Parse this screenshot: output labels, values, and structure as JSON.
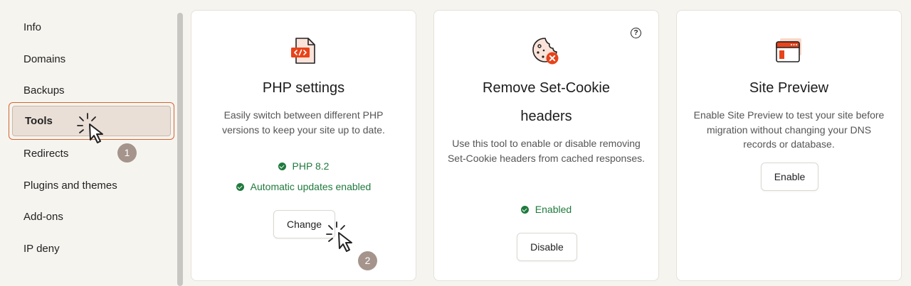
{
  "sidebar": {
    "items": [
      {
        "label": "Info"
      },
      {
        "label": "Domains"
      },
      {
        "label": "Backups"
      },
      {
        "label": "Tools"
      },
      {
        "label": "Redirects"
      },
      {
        "label": "Plugins and themes"
      },
      {
        "label": "Add-ons"
      },
      {
        "label": "IP deny"
      }
    ],
    "active_item": "Tools"
  },
  "step_badges": [
    "1",
    "2"
  ],
  "cards": {
    "php": {
      "title": "PHP settings",
      "description": "Easily switch between different PHP versions to keep your site up to date.",
      "status_1": "PHP 8.2",
      "status_2": "Automatic updates enabled",
      "button": "Change"
    },
    "cookie": {
      "title_line1": "Remove Set-Cookie",
      "title_line2": "headers",
      "description": "Use this tool to enable or disable removing Set-Cookie headers from cached responses.",
      "status": "Enabled",
      "button": "Disable",
      "help": "?"
    },
    "preview": {
      "title": "Site Preview",
      "description": "Enable Site Preview to test your site before migration without changing your DNS records or database.",
      "button": "Enable"
    }
  },
  "colors": {
    "accent": "#e8431a",
    "success": "#1f7a3d",
    "badge": "#a5948b",
    "highlight_border": "#d4652f"
  },
  "icons": [
    "code-file-icon",
    "cookie-remove-icon",
    "browser-window-icon",
    "help-icon",
    "check-circle-icon",
    "pointer-cursor-icon"
  ]
}
